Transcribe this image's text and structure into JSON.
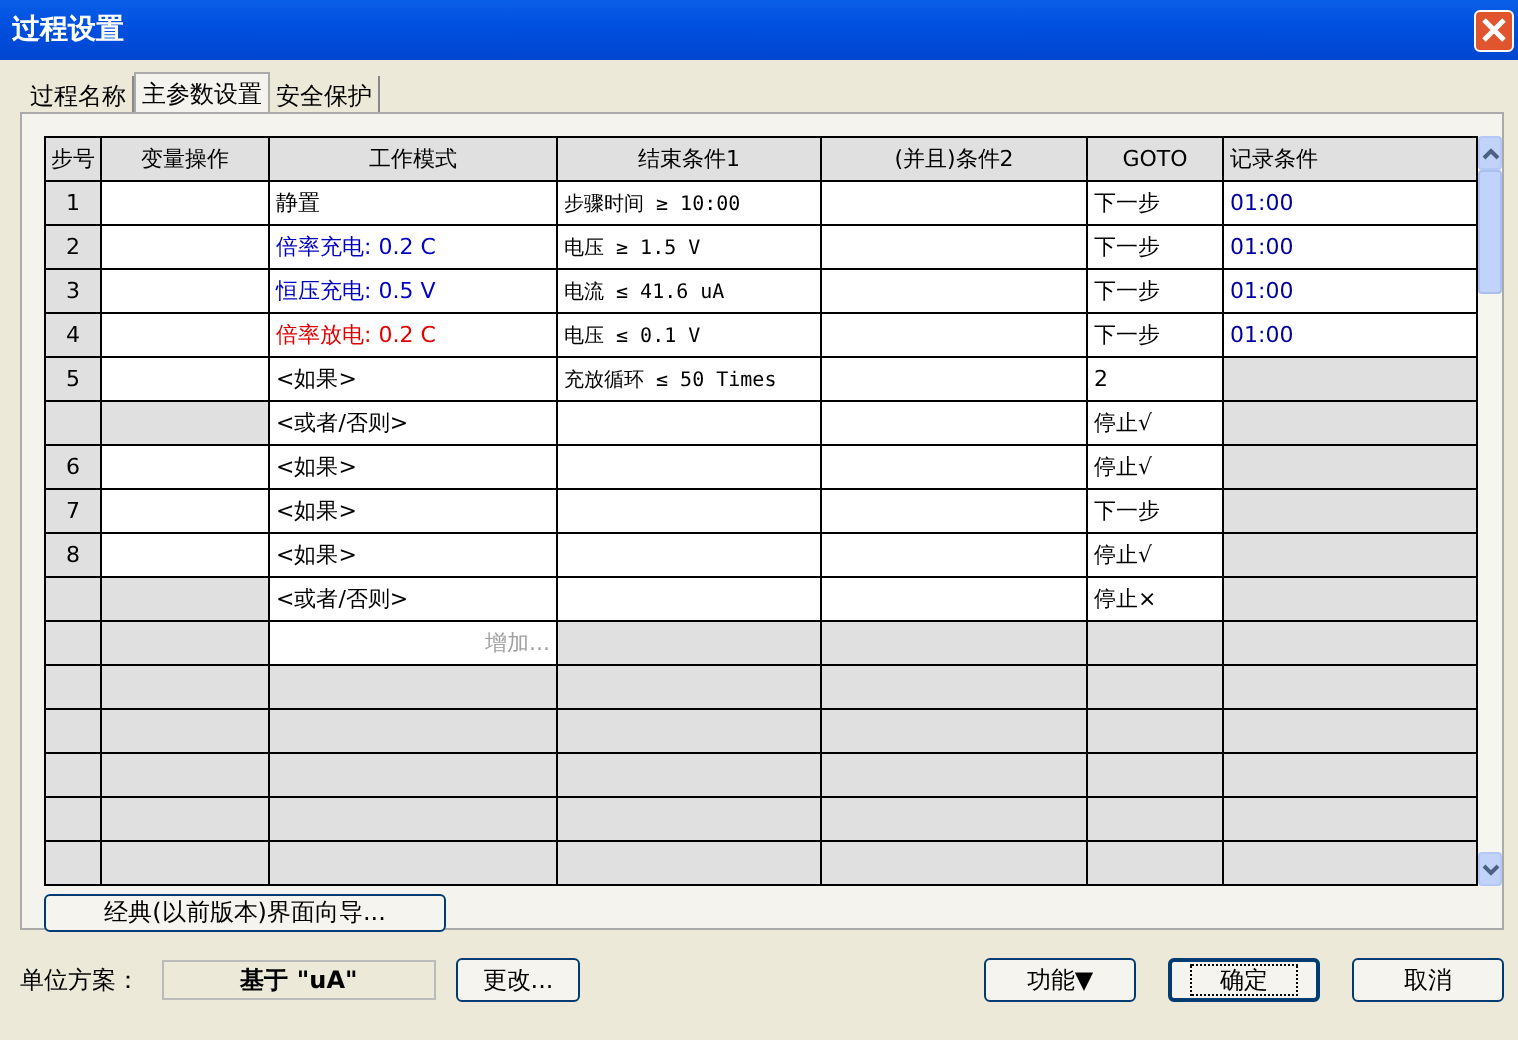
{
  "window": {
    "title": "过程设置"
  },
  "tabs": [
    {
      "label": "过程名称",
      "selected": false
    },
    {
      "label": "主参数设置",
      "selected": true
    },
    {
      "label": "安全保护",
      "selected": false
    }
  ],
  "table": {
    "columns": [
      "步号",
      "变量操作",
      "工作模式",
      "结束条件1",
      "(并且)条件2",
      "GOTO",
      "记录条件"
    ],
    "rows": [
      {
        "kind": "step",
        "step": "1",
        "mode": {
          "text": "静置",
          "color": "#000000"
        },
        "end1": "步骤时间 ≥ 10:00",
        "goto": "下一步",
        "record": "01:00"
      },
      {
        "kind": "step",
        "step": "2",
        "mode": {
          "text": "倍率充电: 0.2 C",
          "color": "#0000c0"
        },
        "end1": "电压 ≥ 1.5 V",
        "goto": "下一步",
        "record": "01:00"
      },
      {
        "kind": "step",
        "step": "3",
        "mode": {
          "text": "恒压充电: 0.5 V",
          "color": "#0000c0"
        },
        "end1": "电流 ≤ 41.6 uA",
        "goto": "下一步",
        "record": "01:00"
      },
      {
        "kind": "step",
        "step": "4",
        "mode": {
          "text": "倍率放电: 0.2 C",
          "color": "#e00000"
        },
        "end1": "电压 ≤ 0.1 V",
        "goto": "下一步",
        "record": "01:00"
      },
      {
        "kind": "step",
        "step": "5",
        "mode": {
          "text": "<如果>",
          "color": "#000000"
        },
        "end1": "充放循环 ≤ 50 Times",
        "goto": "2"
      },
      {
        "kind": "branch",
        "mode": {
          "text": "<或者/否则>",
          "color": "#000000"
        },
        "goto": "停止√"
      },
      {
        "kind": "step",
        "step": "6",
        "mode": {
          "text": "<如果>",
          "color": "#000000"
        },
        "goto": "停止√"
      },
      {
        "kind": "step",
        "step": "7",
        "mode": {
          "text": "<如果>",
          "color": "#000000"
        },
        "goto": "下一步"
      },
      {
        "kind": "step",
        "step": "8",
        "mode": {
          "text": "<如果>",
          "color": "#000000"
        },
        "goto": "停止√"
      },
      {
        "kind": "branch",
        "mode": {
          "text": "<或者/否则>",
          "color": "#000000"
        },
        "goto": "停止×"
      },
      {
        "kind": "add",
        "mode": {
          "text": "增加...",
          "color": "#a0a0a0"
        }
      },
      {
        "kind": "empty"
      },
      {
        "kind": "empty"
      },
      {
        "kind": "empty"
      },
      {
        "kind": "empty"
      },
      {
        "kind": "empty"
      }
    ]
  },
  "wizard_button": "经典(以前版本)界面向导...",
  "unit_scheme": {
    "label": "单位方案：",
    "value": "基于 \"uA\"",
    "change_button": "更改..."
  },
  "buttons": [
    {
      "label": "功能▼",
      "default": false
    },
    {
      "label": "确定",
      "default": true
    },
    {
      "label": "取消",
      "default": false
    }
  ]
}
